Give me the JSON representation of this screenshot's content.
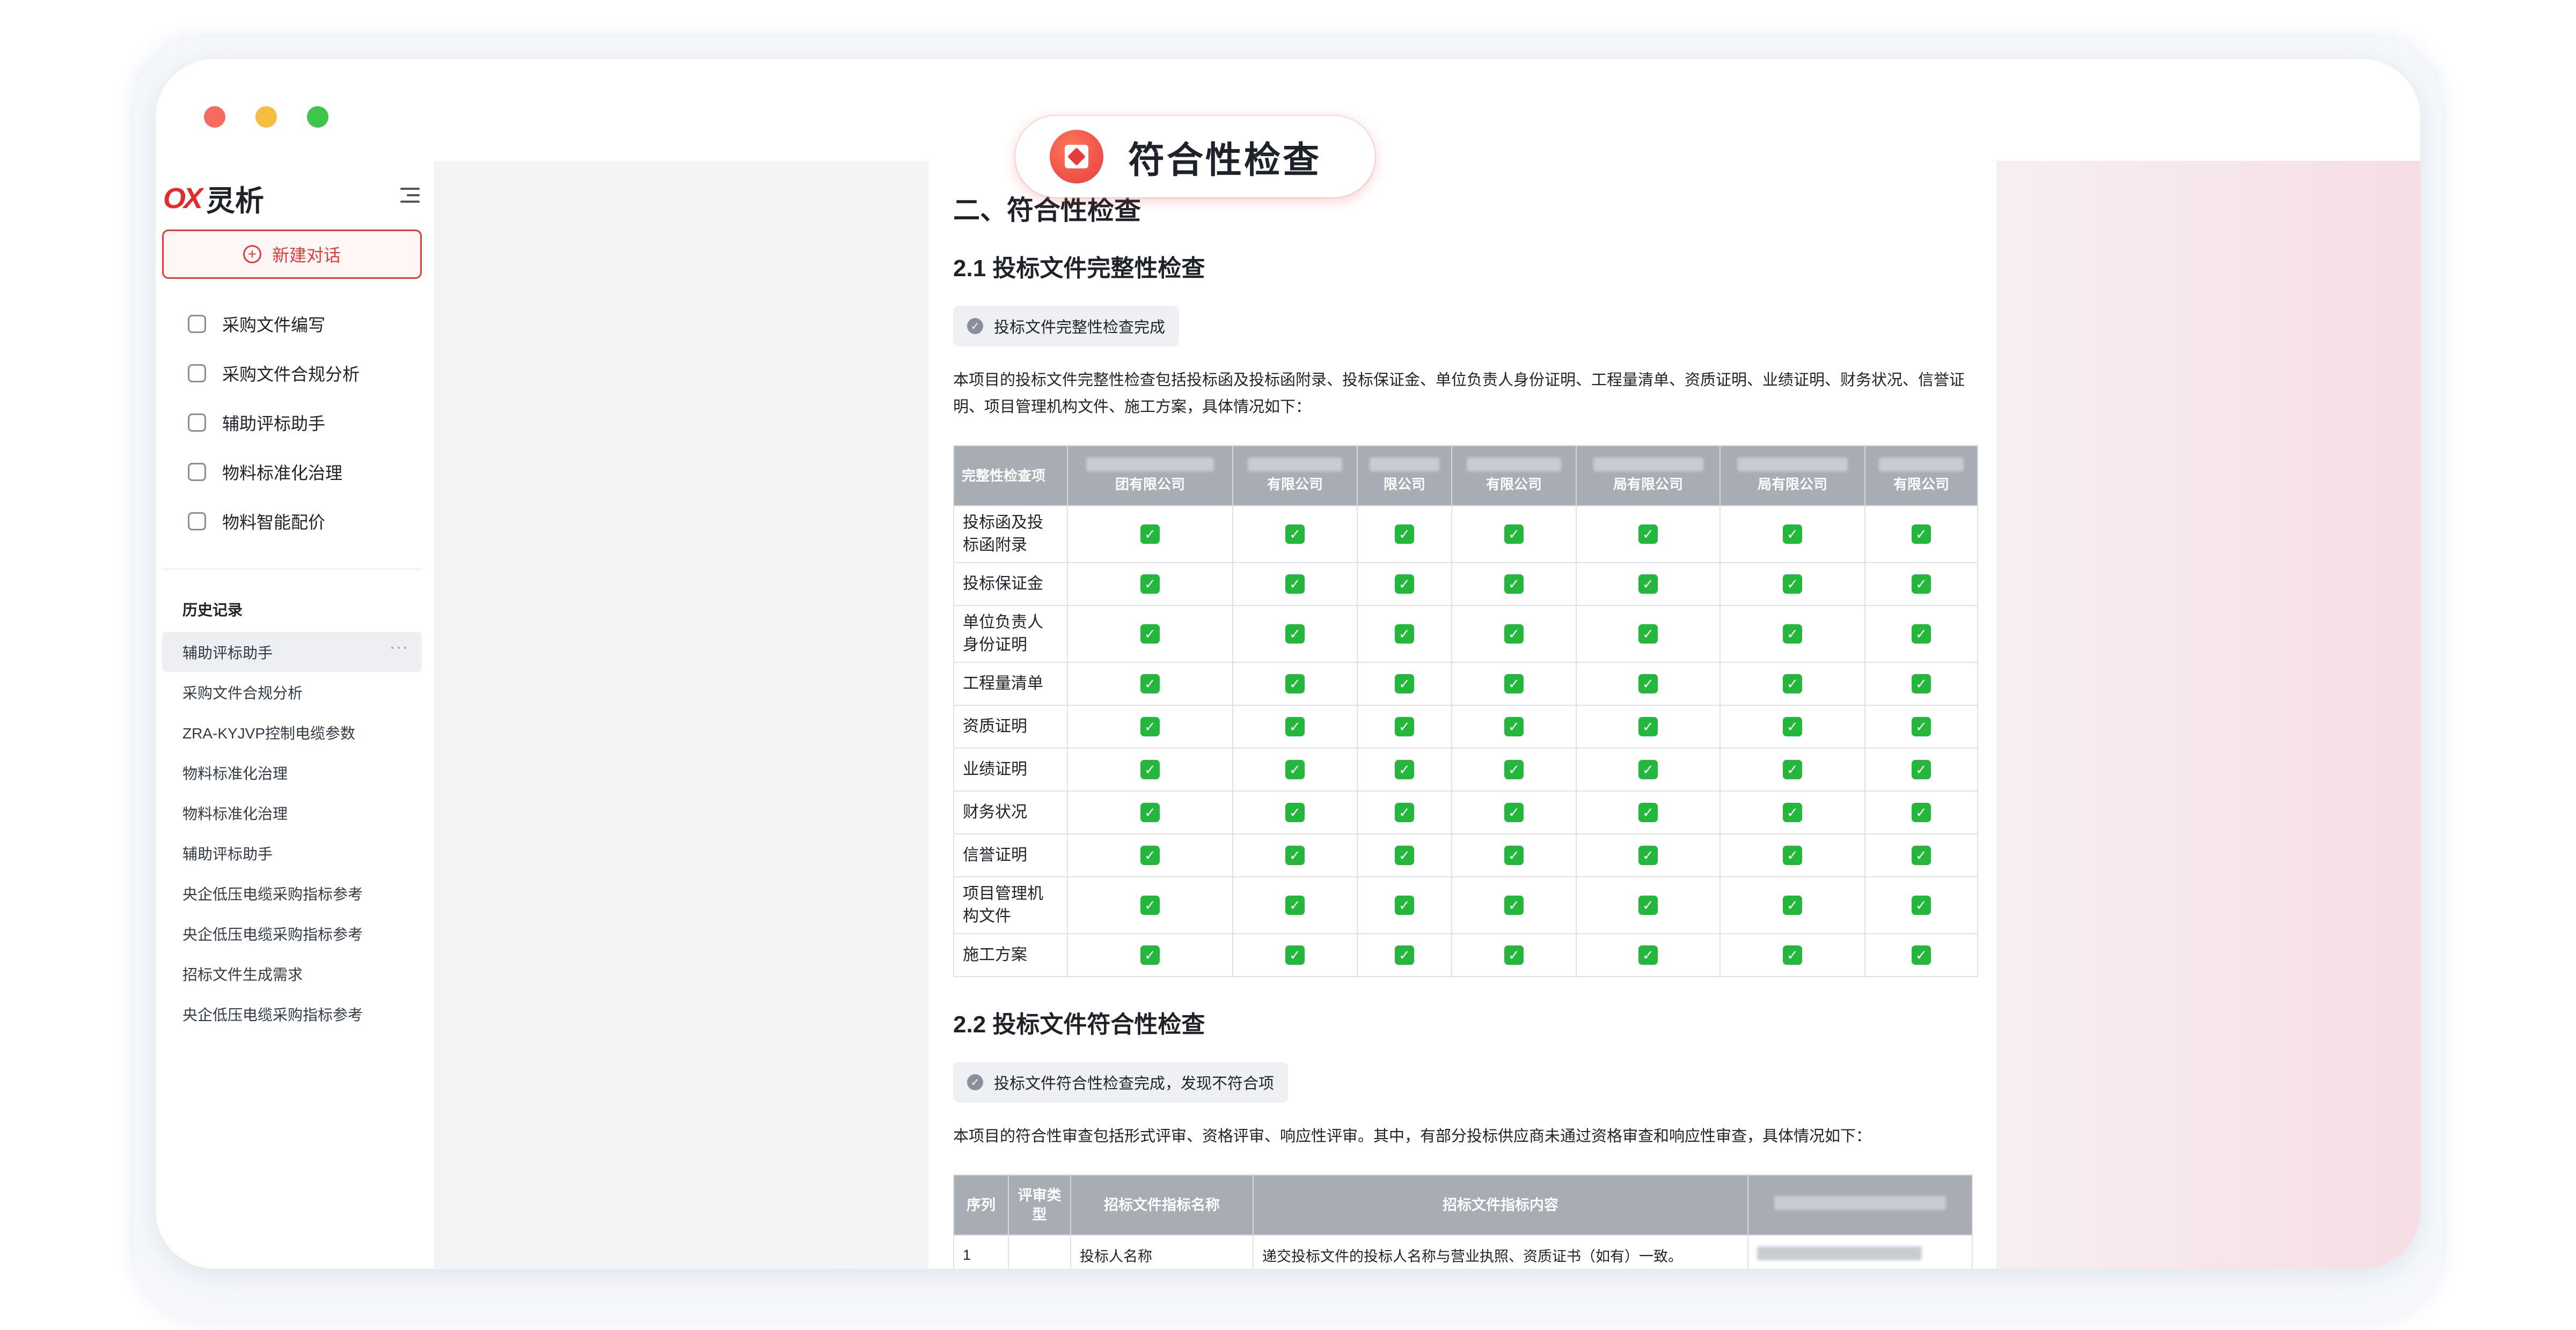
{
  "window": {
    "title": "符合性检查"
  },
  "sidebar": {
    "brand_mark": "OX",
    "brand_name": "灵析",
    "new_chat_label": "新建对话",
    "nav": [
      {
        "label": "采购文件编写",
        "icon": "stamp-icon"
      },
      {
        "label": "采购文件合规分析",
        "icon": "documents-icon"
      },
      {
        "label": "辅助评标助手",
        "icon": "tag-icon"
      },
      {
        "label": "物料标准化治理",
        "icon": "list-sort-icon"
      },
      {
        "label": "物料智能配价",
        "icon": "bulb-icon"
      }
    ],
    "history_title": "历史记录",
    "history": [
      {
        "label": "辅助评标助手",
        "active": true
      },
      {
        "label": "采购文件合规分析"
      },
      {
        "label": "ZRA-KYJVP控制电缆参数"
      },
      {
        "label": "物料标准化治理"
      },
      {
        "label": "物料标准化治理"
      },
      {
        "label": "辅助评标助手"
      },
      {
        "label": "央企低压电缆采购指标参考"
      },
      {
        "label": "央企低压电缆采购指标参考"
      },
      {
        "label": "招标文件生成需求"
      },
      {
        "label": "央企低压电缆采购指标参考"
      }
    ],
    "more_glyph": "···"
  },
  "doc": {
    "h1": "二、符合性检查",
    "section1": {
      "title": "2.1 投标文件完整性检查",
      "status": "投标文件完整性检查完成",
      "intro": "本项目的投标文件完整性检查包括投标函及投标函附录、投标保证金、单位负责人身份证明、工程量清单、资质证明、业绩证明、财务状况、信誉证明、项目管理机构文件、施工方案，具体情况如下：",
      "table": {
        "first_header": "完整性检查项",
        "company_headers": [
          "团有限公司",
          "有限公司",
          "限公司",
          "有限公司",
          "局有限公司",
          "局有限公司",
          "有限公司"
        ],
        "rows": [
          "投标函及投标函附录",
          "投标保证金",
          "单位负责人身份证明",
          "工程量清单",
          "资质证明",
          "业绩证明",
          "财务状况",
          "信誉证明",
          "项目管理机构文件",
          "施工方案"
        ],
        "check_glyph": "✓"
      }
    },
    "section2": {
      "title": "2.2 投标文件符合性检查",
      "status": "投标文件符合性检查完成，发现不符合项",
      "intro": "本项目的符合性审查包括形式评审、资格评审、响应性评审。其中，有部分投标供应商未通过资格审查和响应性审查，具体情况如下：",
      "table": {
        "headers": [
          "序列",
          "评审类型",
          "招标文件指标名称",
          "招标文件指标内容"
        ],
        "rows": [
          {
            "seq": "1",
            "type": "",
            "name": "投标人名称",
            "content": "递交投标文件的投标人名称与营业执照、资质证书（如有）一致。"
          }
        ]
      }
    }
  },
  "colors": {
    "accent": "#e43c3c",
    "check": "#23b83b",
    "table_header": "#a7acb5"
  }
}
